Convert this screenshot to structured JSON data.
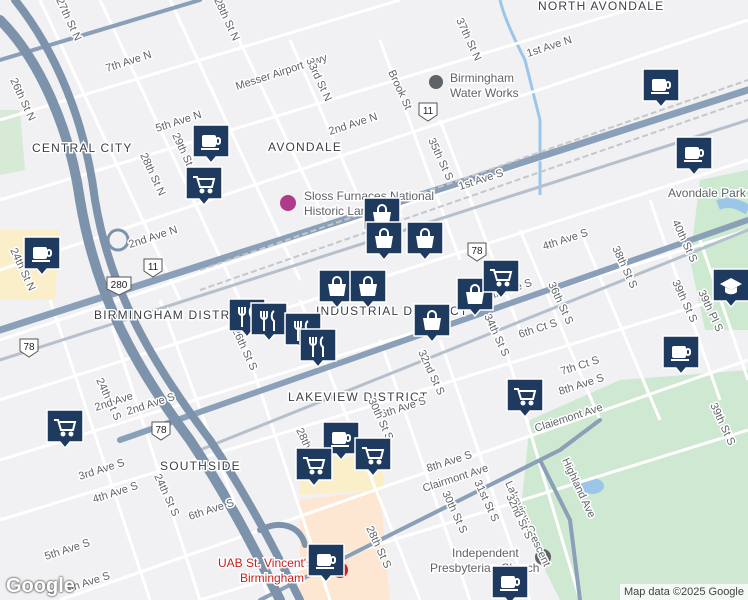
{
  "attribution": "Map data ©2025 Google",
  "logo": "Google",
  "colors": {
    "background": "#f1f0f3",
    "major_road": "#8aa0b8",
    "highway": "#7d93ab",
    "street": "#ffffff",
    "park": "#bfe0c3",
    "water": "#9cc6e8",
    "marker": "#1e3a5f"
  },
  "areas": [
    "CENTRAL CITY",
    "AVONDALE",
    "NORTH AVONDALE",
    "BIRMINGHAM DISTRICT",
    "INDUSTRIAL DISTRICT",
    "LAKEVIEW DISTRICT",
    "SOUTHSIDE"
  ],
  "places": {
    "water_works": [
      "Birmingham",
      "Water Works"
    ],
    "sloss": [
      "Sloss Furnaces National",
      "Historic Landmark"
    ],
    "avondale_park": "Avondale Park",
    "church": [
      "Independent",
      "Presbyterian Church"
    ],
    "uab": [
      "UAB St. Vincent's",
      "Birmingham"
    ]
  },
  "streets": [
    "26th St N",
    "27th St N",
    "28th St N",
    "24th St N",
    "Messer Airport Hwy",
    "7th Ave N",
    "33rd St N",
    "5th Ave N",
    "29th St N",
    "2nd Ave N",
    "28th St N",
    "2nd Ave N",
    "1st Ave N",
    "37th St N",
    "Brook St",
    "35th St S",
    "1st Ave S",
    "32nd St S",
    "4th Ave S",
    "40th St S",
    "38th St S",
    "36th St S",
    "34th St S",
    "6th Ct S",
    "7th Ct S",
    "39th Pl S",
    "39th St S",
    "39th St S",
    "8th Ave S",
    "Claiemont Ave",
    "6th Ave S",
    "5th Ave S",
    "2nd Ave S",
    "3rd Ave S",
    "4th Ave S",
    "24th St S",
    "6th Ave S",
    "5th Ave S",
    "6th Ave S",
    "8th Ave S",
    "Clairmont Ave",
    "Lakeview Crescent",
    "Highland Ave",
    "30th St S",
    "31st St S",
    "32nd St S",
    "28th St S",
    "24th St S",
    "30th St S",
    "28th St S",
    "26th St S",
    "2nd Ave"
  ],
  "shields": [
    "11",
    "11",
    "280",
    "78",
    "78",
    "78"
  ],
  "markers": [
    {
      "type": "coffee",
      "count": 1
    },
    {
      "type": "cart",
      "count": 1
    },
    {
      "type": "coffee",
      "count": 1
    },
    {
      "type": "coffee",
      "count": 1
    },
    {
      "type": "coffee",
      "count": 1
    },
    {
      "type": "bag",
      "count": 1
    },
    {
      "type": "bag",
      "count": 1
    },
    {
      "type": "bag",
      "count": 1
    },
    {
      "type": "bag",
      "count": 1
    },
    {
      "type": "bag",
      "count": 1
    },
    {
      "type": "bag",
      "count": 1
    },
    {
      "type": "bag",
      "count": 1
    },
    {
      "type": "cart",
      "count": 1
    },
    {
      "type": "restaurant",
      "count": 1
    },
    {
      "type": "restaurant",
      "count": 1
    },
    {
      "type": "restaurant",
      "count": 1
    },
    {
      "type": "restaurant",
      "count": 1
    },
    {
      "type": "coffee",
      "count": 1
    },
    {
      "type": "cart",
      "count": 1
    },
    {
      "type": "cart",
      "count": 1
    },
    {
      "type": "coffee",
      "count": 1
    },
    {
      "type": "cart",
      "count": 1
    },
    {
      "type": "cart",
      "count": 1
    },
    {
      "type": "coffee",
      "count": 1
    },
    {
      "type": "coffee",
      "count": 1
    },
    {
      "type": "school",
      "count": 1
    }
  ]
}
